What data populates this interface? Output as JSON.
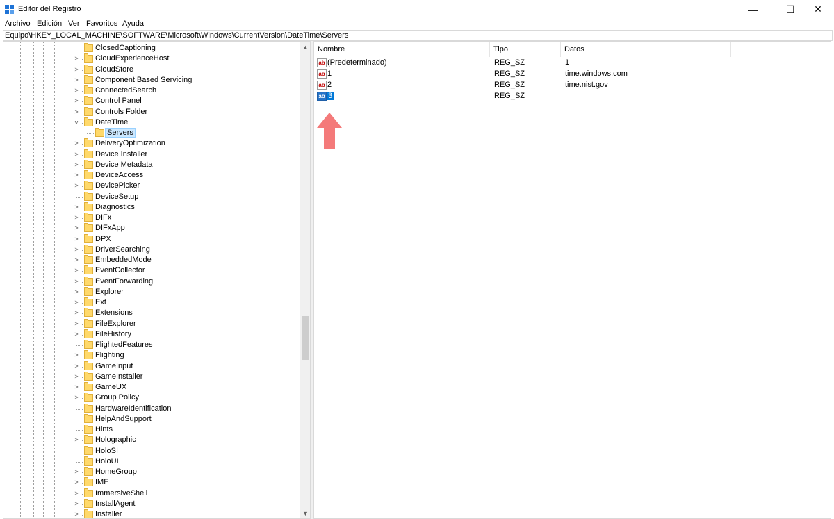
{
  "window": {
    "title": "Editor del Registro",
    "controls": {
      "minimize": "—",
      "maximize": "☐",
      "close": "✕"
    }
  },
  "menu": [
    "Archivo",
    "Edición",
    "Ver",
    "Favoritos",
    "Ayuda"
  ],
  "address": "Equipo\\HKEY_LOCAL_MACHINE\\SOFTWARE\\Microsoft\\Windows\\CurrentVersion\\DateTime\\Servers",
  "tree": {
    "items": [
      {
        "label": "ClosedCaptioning",
        "expander": "",
        "depth": 0
      },
      {
        "label": "CloudExperienceHost",
        "expander": ">",
        "depth": 0
      },
      {
        "label": "CloudStore",
        "expander": ">",
        "depth": 0
      },
      {
        "label": "Component Based Servicing",
        "expander": ">",
        "depth": 0
      },
      {
        "label": "ConnectedSearch",
        "expander": ">",
        "depth": 0
      },
      {
        "label": "Control Panel",
        "expander": ">",
        "depth": 0
      },
      {
        "label": "Controls Folder",
        "expander": ">",
        "depth": 0
      },
      {
        "label": "DateTime",
        "expander": "v",
        "depth": 0
      },
      {
        "label": "Servers",
        "expander": "",
        "depth": 1,
        "selected": true
      },
      {
        "label": "DeliveryOptimization",
        "expander": ">",
        "depth": 0
      },
      {
        "label": "Device Installer",
        "expander": ">",
        "depth": 0
      },
      {
        "label": "Device Metadata",
        "expander": ">",
        "depth": 0
      },
      {
        "label": "DeviceAccess",
        "expander": ">",
        "depth": 0
      },
      {
        "label": "DevicePicker",
        "expander": ">",
        "depth": 0
      },
      {
        "label": "DeviceSetup",
        "expander": "",
        "depth": 0
      },
      {
        "label": "Diagnostics",
        "expander": ">",
        "depth": 0
      },
      {
        "label": "DIFx",
        "expander": ">",
        "depth": 0
      },
      {
        "label": "DIFxApp",
        "expander": ">",
        "depth": 0
      },
      {
        "label": "DPX",
        "expander": ">",
        "depth": 0
      },
      {
        "label": "DriverSearching",
        "expander": ">",
        "depth": 0
      },
      {
        "label": "EmbeddedMode",
        "expander": ">",
        "depth": 0
      },
      {
        "label": "EventCollector",
        "expander": ">",
        "depth": 0
      },
      {
        "label": "EventForwarding",
        "expander": ">",
        "depth": 0
      },
      {
        "label": "Explorer",
        "expander": ">",
        "depth": 0
      },
      {
        "label": "Ext",
        "expander": ">",
        "depth": 0
      },
      {
        "label": "Extensions",
        "expander": ">",
        "depth": 0
      },
      {
        "label": "FileExplorer",
        "expander": ">",
        "depth": 0
      },
      {
        "label": "FileHistory",
        "expander": ">",
        "depth": 0
      },
      {
        "label": "FlightedFeatures",
        "expander": "",
        "depth": 0
      },
      {
        "label": "Flighting",
        "expander": ">",
        "depth": 0
      },
      {
        "label": "GameInput",
        "expander": ">",
        "depth": 0
      },
      {
        "label": "GameInstaller",
        "expander": ">",
        "depth": 0
      },
      {
        "label": "GameUX",
        "expander": ">",
        "depth": 0
      },
      {
        "label": "Group Policy",
        "expander": ">",
        "depth": 0
      },
      {
        "label": "HardwareIdentification",
        "expander": "",
        "depth": 0
      },
      {
        "label": "HelpAndSupport",
        "expander": "",
        "depth": 0
      },
      {
        "label": "Hints",
        "expander": "",
        "depth": 0
      },
      {
        "label": "Holographic",
        "expander": ">",
        "depth": 0
      },
      {
        "label": "HoloSI",
        "expander": "",
        "depth": 0
      },
      {
        "label": "HoloUI",
        "expander": "",
        "depth": 0
      },
      {
        "label": "HomeGroup",
        "expander": ">",
        "depth": 0
      },
      {
        "label": "IME",
        "expander": ">",
        "depth": 0
      },
      {
        "label": "ImmersiveShell",
        "expander": ">",
        "depth": 0
      },
      {
        "label": "InstallAgent",
        "expander": ">",
        "depth": 0
      },
      {
        "label": "Installer",
        "expander": ">",
        "depth": 0
      }
    ]
  },
  "list": {
    "columns": {
      "name": "Nombre",
      "type": "Tipo",
      "data": "Datos"
    },
    "rows": [
      {
        "icon": "ab",
        "name": "(Predeterminado)",
        "type": "REG_SZ",
        "data": "1",
        "selected": false
      },
      {
        "icon": "ab",
        "name": "1",
        "type": "REG_SZ",
        "data": "time.windows.com",
        "selected": false
      },
      {
        "icon": "ab",
        "name": "2",
        "type": "REG_SZ",
        "data": "time.nist.gov",
        "selected": false
      },
      {
        "icon": "ab",
        "name": "3",
        "type": "REG_SZ",
        "data": "",
        "selected": true
      }
    ]
  },
  "colors": {
    "annotation_arrow": "#f47a7a",
    "selection": "#0078d7",
    "folder": "#ffd96b"
  },
  "icons": [
    "registry-editor-icon",
    "folder-icon",
    "string-value-icon",
    "up-arrow-annotation"
  ]
}
